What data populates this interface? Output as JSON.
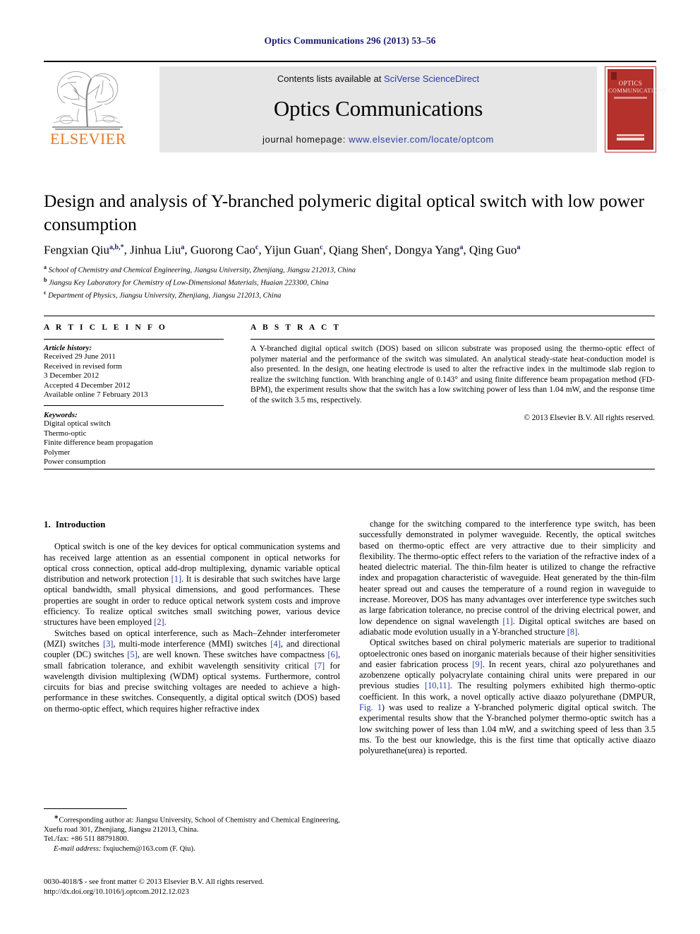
{
  "running_head": "Optics Communications 296 (2013) 53–56",
  "masthead": {
    "contents_prefix": "Contents lists available at ",
    "contents_link": "SciVerse ScienceDirect",
    "journal_title": "Optics Communications",
    "homepage_prefix": "journal homepage: ",
    "homepage_link": "www.elsevier.com/locate/optcom",
    "publisher_name": "ELSEVIER",
    "cover_line1": "OPTICS",
    "cover_line2": "COMMUNICATIONS"
  },
  "article": {
    "title": "Design and analysis of Y-branched polymeric digital optical switch with low power consumption",
    "authors": [
      {
        "name": "Fengxian Qiu",
        "sup": "a,b,*"
      },
      {
        "name": "Jinhua Liu",
        "sup": "a"
      },
      {
        "name": "Guorong Cao",
        "sup": "c"
      },
      {
        "name": "Yijun Guan",
        "sup": "c"
      },
      {
        "name": "Qiang Shen",
        "sup": "c"
      },
      {
        "name": "Dongya Yang",
        "sup": "a"
      },
      {
        "name": "Qing Guo",
        "sup": "a"
      }
    ],
    "affiliations": [
      {
        "sup": "a",
        "text": "School of Chemistry and Chemical Engineering, Jiangsu University, Zhenjiang, Jiangsu 212013, China"
      },
      {
        "sup": "b",
        "text": "Jiangsu Key Laboratory for Chemistry of Low-Dimensional Materials, Huaian 223300, China"
      },
      {
        "sup": "c",
        "text": "Department of Physics, Jiangsu University, Zhenjiang, Jiangsu 212013, China"
      }
    ]
  },
  "article_info": {
    "heading": "A R T I C L E   I N F O",
    "history_label": "Article history:",
    "history": [
      "Received 29 June 2011",
      "Received in revised form",
      "3 December 2012",
      "Accepted 4 December 2012",
      "Available online 7 February 2013"
    ],
    "keywords_label": "Keywords:",
    "keywords": [
      "Digital optical switch",
      "Thermo-optic",
      "Finite difference beam propagation",
      "Polymer",
      "Power consumption"
    ]
  },
  "abstract": {
    "heading": "A B S T R A C T",
    "text": "A Y-branched digital optical switch (DOS) based on silicon substrate was proposed using the thermo-optic effect of polymer material and the performance of the switch was simulated. An analytical steady-state heat-conduction model is also presented. In the design, one heating electrode is used to alter the refractive index in the multimode slab region to realize the switching function. With branching angle of 0.143° and using finite difference beam propagation method (FD-BPM), the experiment results show that the switch has a low switching power of less than 1.04 mW, and the response time of the switch 3.5 ms, respectively.",
    "copyright": "© 2013 Elsevier B.V. All rights reserved."
  },
  "body": {
    "section_number": "1.",
    "section_title": "Introduction",
    "left_paragraphs": [
      "Optical switch is one of the key devices for optical communication systems and has received large attention as an essential component in optical networks for optical cross connection, optical add-drop multiplexing, dynamic variable optical distribution and network protection [1]. It is desirable that such switches have large optical bandwidth, small physical dimensions, and good performances. These properties are sought in order to reduce optical network system costs and improve efficiency. To realize optical switches small switching power, various device structures have been employed [2].",
      "Switches based on optical interference, such as Mach–Zehnder interferometer (MZI) switches [3], multi-mode interference (MMI) switches [4], and directional coupler (DC) switches [5], are well known. These switches have compactness [6], small fabrication tolerance, and exhibit wavelength sensitivity critical [7] for wavelength division multiplexing (WDM) optical systems. Furthermore, control circuits for bias and precise switching voltages are needed to achieve a high-performance in these switches. Consequently, a digital optical switch (DOS) based on thermo-optic effect, which requires higher refractive index"
    ],
    "right_paragraphs": [
      "change for the switching compared to the interference type switch, has been successfully demonstrated in polymer waveguide. Recently, the optical switches based on thermo-optic effect are very attractive due to their simplicity and flexibility. The thermo-optic effect refers to the variation of the refractive index of a heated dielectric material. The thin-film heater is utilized to change the refractive index and propagation characteristic of waveguide. Heat generated by the thin-film heater spread out and causes the temperature of a round region in waveguide to increase. Moreover, DOS has many advantages over interference type switches such as large fabrication tolerance, no precise control of the driving electrical power, and low dependence on signal wavelength [1]. Digital optical switches are based on adiabatic mode evolution usually in a Y-branched structure [8].",
      "Optical switches based on chiral polymeric materials are superior to traditional optoelectronic ones based on inorganic materials because of their higher sensitivities and easier fabrication process [9]. In recent years, chiral azo polyurethanes and azobenzene optically polyacrylate containing chiral units were prepared in our previous studies [10,11]. The resulting polymers exhibited high thermo-optic coefficient. In this work, a novel optically active diaazo polyurethane (DMPUR, Fig. 1) was used to realize a Y-branched polymeric digital optical switch. The experimental results show that the Y-branched polymer thermo-optic switch has a low switching power of less than 1.04 mW, and a switching speed of less than 3.5 ms. To the best our knowledge, this is the first time that optically active diaazo polyurethane(urea) is reported."
    ]
  },
  "footnote": {
    "corresponding": "Corresponding author at: Jiangsu University, School of Chemistry and Chemical Engineering, Xuefu road 301, Zhenjiang, Jiangsu 212013, China.",
    "telfax": "Tel./fax: +86 511 88791800.",
    "email_label": "E-mail address:",
    "email": "fxqiuchem@163.com (F. Qiu).",
    "imprint_line": "0030-4018/$ - see front matter © 2013 Elsevier B.V. All rights reserved.",
    "doi_line": "http://dx.doi.org/10.1016/j.optcom.2012.12.023"
  },
  "colors": {
    "link_blue": "#2b3d9e",
    "header_navy": "#1b1b6f",
    "elsevier_orange": "#e87722",
    "cover_red": "#b5312c"
  }
}
